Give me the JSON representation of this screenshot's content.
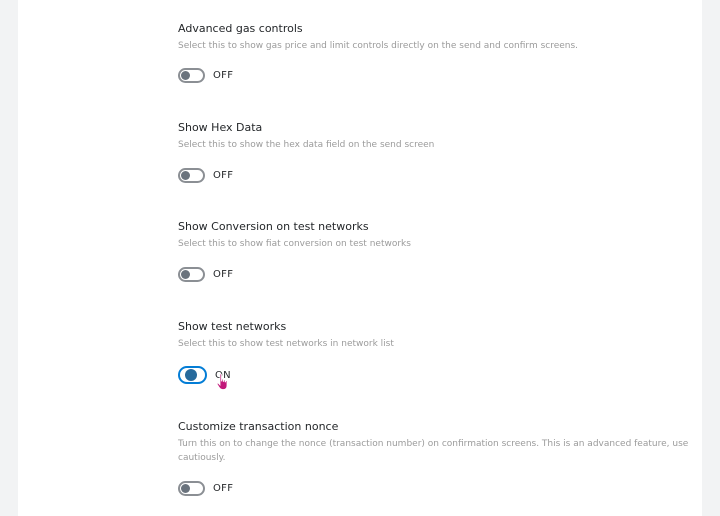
{
  "settings": [
    {
      "title": "Advanced gas controls",
      "description": "Select this to show gas price and limit controls directly on the send and confirm screens.",
      "state": "OFF",
      "enabled": false
    },
    {
      "title": "Show Hex Data",
      "description": "Select this to show the hex data field on the send screen",
      "state": "OFF",
      "enabled": false
    },
    {
      "title": "Show Conversion on test networks",
      "description": "Select this to show fiat conversion on test networks",
      "state": "OFF",
      "enabled": false
    },
    {
      "title": "Show test networks",
      "description": "Select this to show test networks in network list",
      "state": "ON",
      "enabled": true
    },
    {
      "title": "Customize transaction nonce",
      "description": "Turn this on to change the nonce (transaction number) on confirmation screens. This is an advanced feature, use cautiously.",
      "state": "OFF",
      "enabled": false
    }
  ],
  "colors": {
    "toggle_on_border": "#037dd6",
    "toggle_on_knob": "#276a9c",
    "toggle_off_border": "#8b8f94",
    "toggle_off_knob": "#6a737d",
    "cursor": "#c2187a"
  },
  "icons": {
    "cursor": "hand-pointer-cursor-icon"
  }
}
